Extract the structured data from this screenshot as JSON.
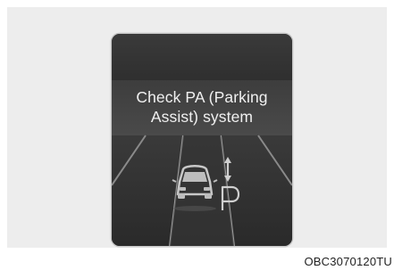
{
  "display": {
    "message_line1": "Check PA (Parking",
    "message_line2": "Assist) system"
  },
  "icons": {
    "car": "car-icon",
    "arrow": "up-down-arrow-icon",
    "parking": "parking-icon"
  },
  "caption": "OBC3070120TU",
  "colors": {
    "display_bg": "#2b2b2b",
    "message_band": "#444444",
    "text": "#f0f0f0",
    "road_lines": "#bdbdbd"
  }
}
